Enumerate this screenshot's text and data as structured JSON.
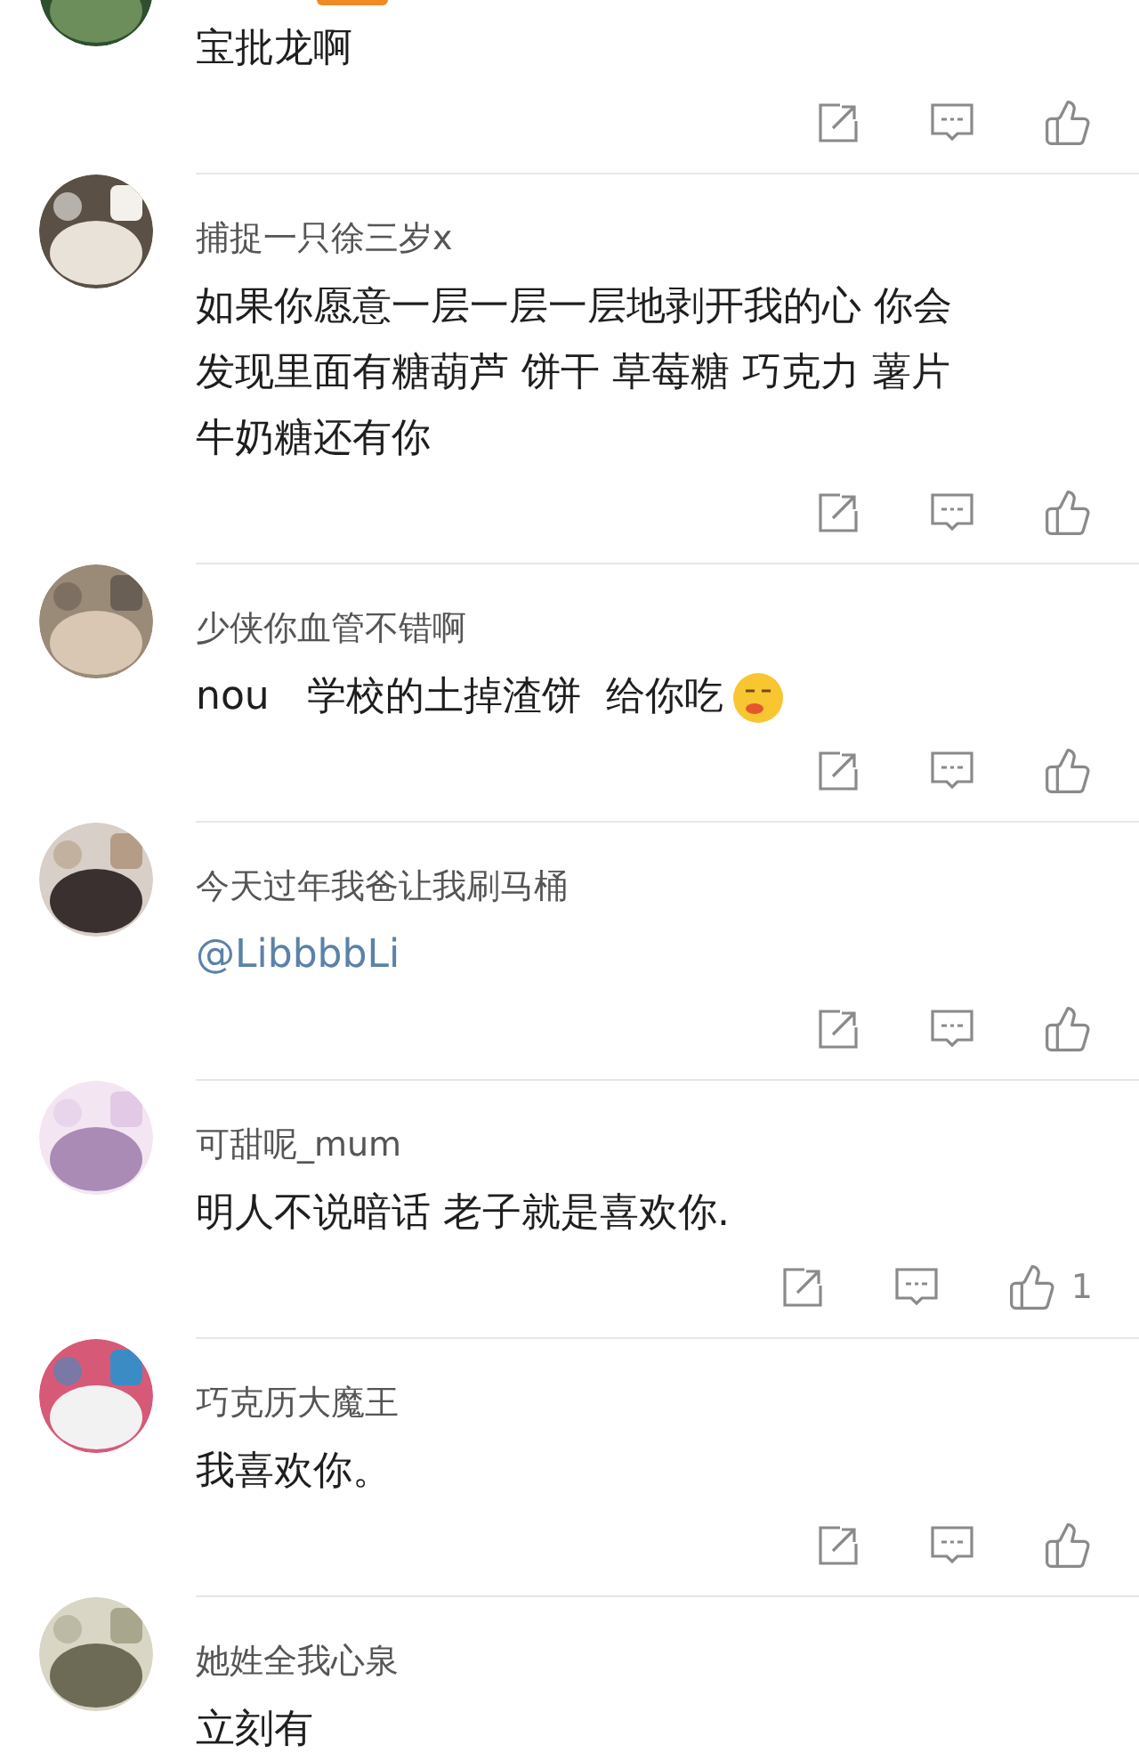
{
  "comments": [
    {
      "kind": "text",
      "body": [
        "宝批龙啊"
      ]
    },
    {
      "kind": "text",
      "name": "捕捉一只徐三岁x",
      "body": [
        "如果你愿意一层一层一层地剥开我的心 你会",
        "发现里面有糖葫芦 饼干 草莓糖 巧克力 薯片",
        "牛奶糖还有你"
      ]
    },
    {
      "kind": "text",
      "name": "少侠你血管不错啊",
      "body": [
        "nou   学校的土掉渣饼  给你吃"
      ],
      "has_emoji": true
    },
    {
      "kind": "mention",
      "name": "今天过年我爸让我刷马桶",
      "body": [
        "@LibbbbLi"
      ]
    },
    {
      "kind": "text",
      "name": "可甜呢_mum",
      "body": [
        "明人不说暗话 老子就是喜欢你."
      ],
      "likes": "1"
    },
    {
      "kind": "text",
      "name": "巧克历大魔王",
      "body": [
        "我喜欢你。"
      ]
    },
    {
      "kind": "text",
      "name": "她姓全我心泉",
      "body": [
        "立刻有"
      ]
    }
  ]
}
